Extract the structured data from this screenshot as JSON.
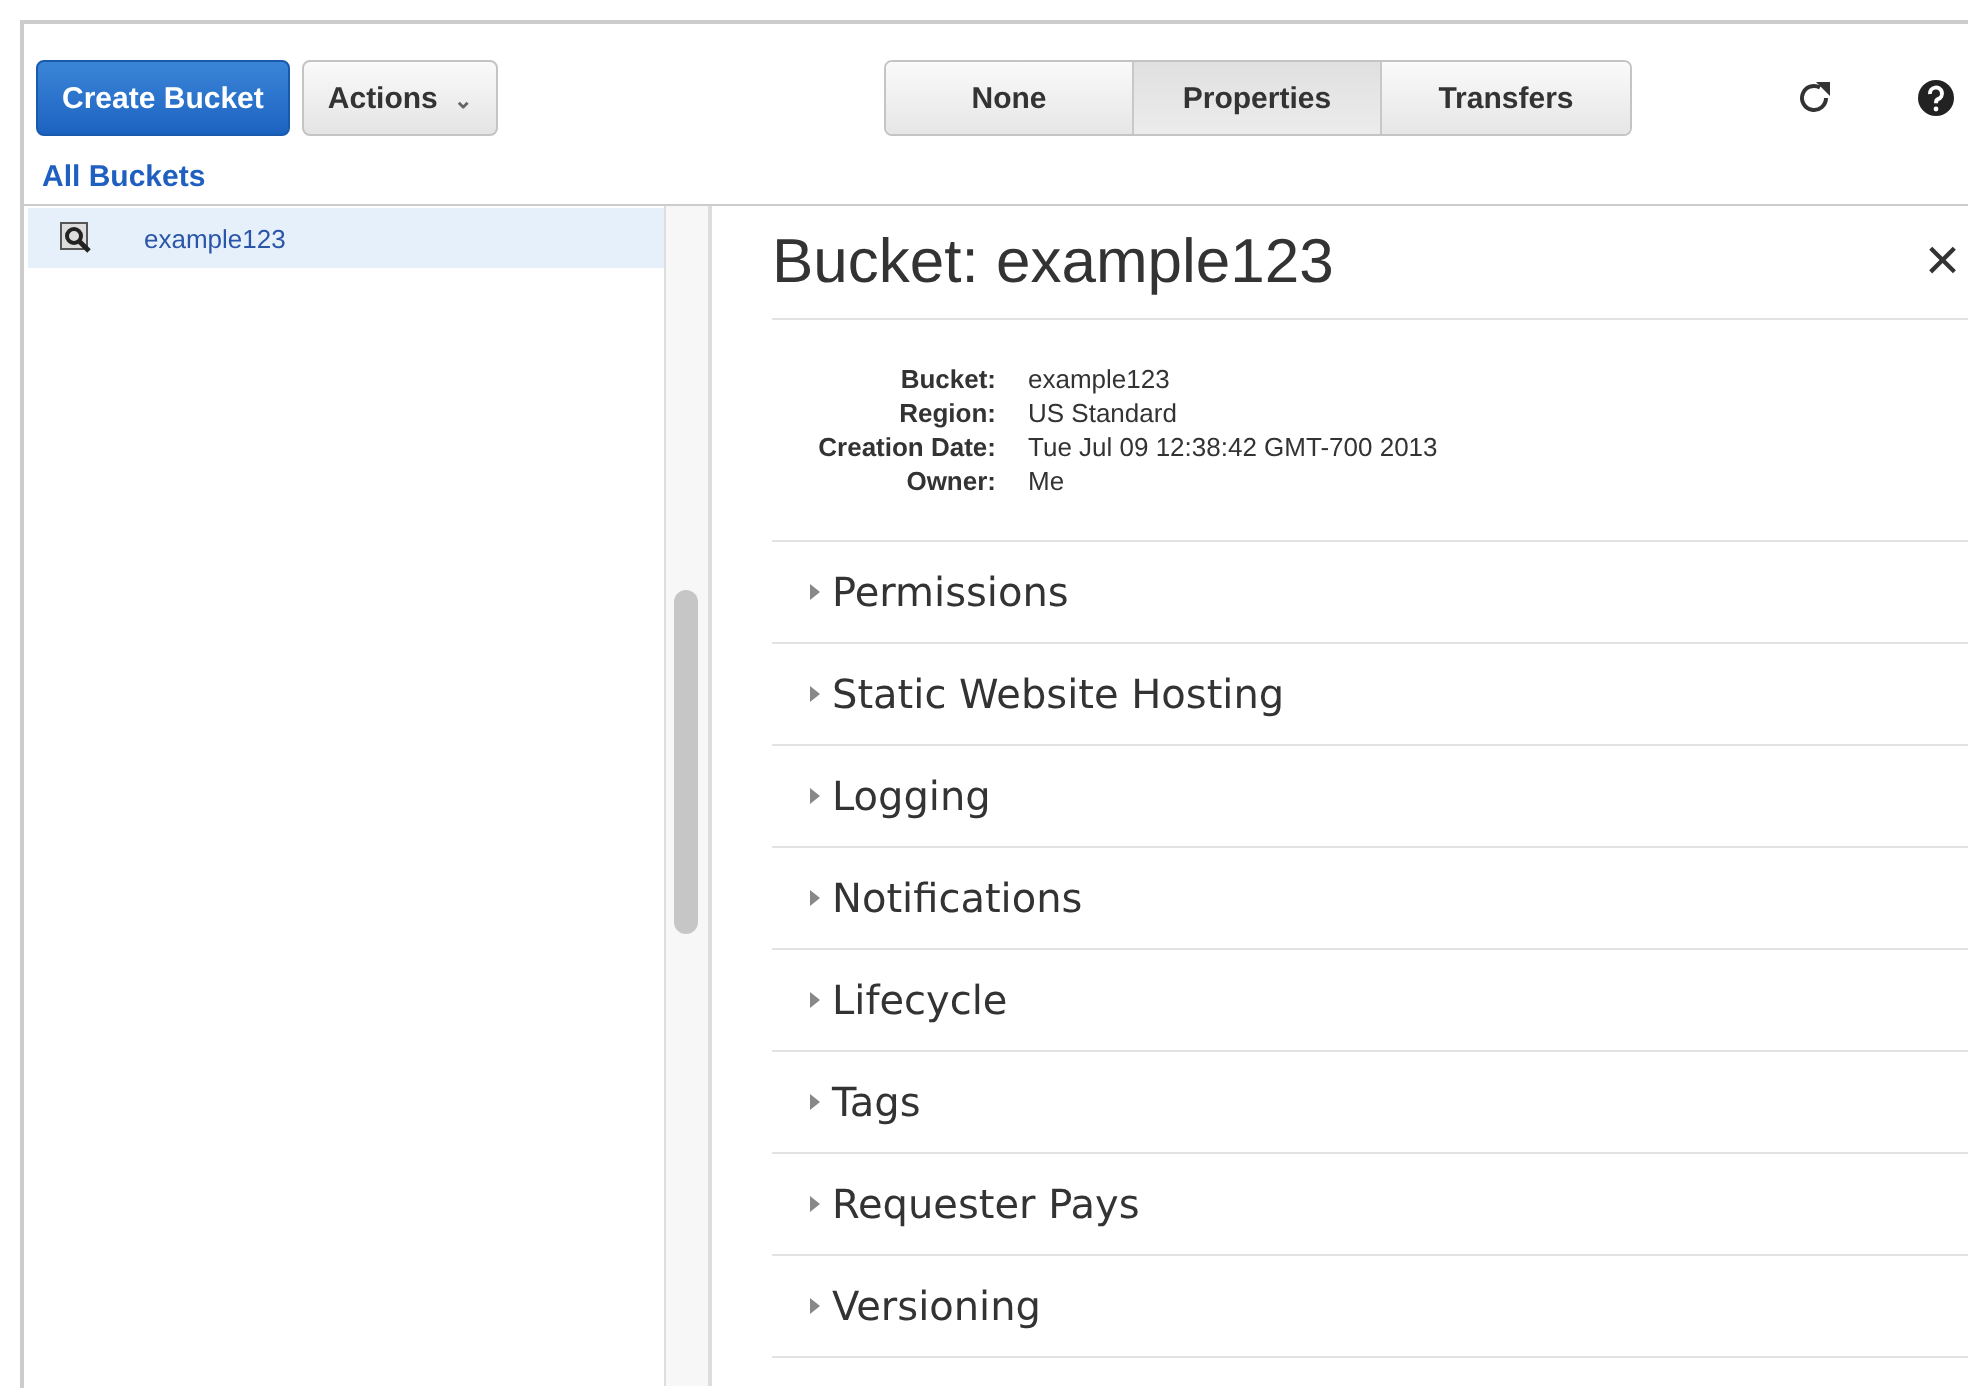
{
  "toolbar": {
    "create_button": "Create Bucket",
    "actions_button": "Actions",
    "caret": "⌄",
    "view_tabs": [
      {
        "label": "None",
        "selected": false
      },
      {
        "label": "Properties",
        "selected": true
      },
      {
        "label": "Transfers",
        "selected": false
      }
    ]
  },
  "sidebar": {
    "heading": "All Buckets",
    "items": [
      {
        "label": "example123",
        "selected": true
      }
    ]
  },
  "panel": {
    "title": "Bucket: example123",
    "close": "×",
    "details": [
      {
        "label": "Bucket:",
        "value": "example123"
      },
      {
        "label": "Region:",
        "value": "US Standard"
      },
      {
        "label": "Creation Date:",
        "value": "Tue Jul 09 12:38:42 GMT-700 2013"
      },
      {
        "label": "Owner:",
        "value": "Me"
      }
    ],
    "sections": [
      {
        "label": "Permissions",
        "expanded": false
      },
      {
        "label": "Static Website Hosting",
        "expanded": false
      },
      {
        "label": "Logging",
        "expanded": false
      },
      {
        "label": "Notifications",
        "expanded": false
      },
      {
        "label": "Lifecycle",
        "expanded": false
      },
      {
        "label": "Tags",
        "expanded": false
      },
      {
        "label": "Requester Pays",
        "expanded": false
      },
      {
        "label": "Versioning",
        "expanded": false
      }
    ]
  }
}
